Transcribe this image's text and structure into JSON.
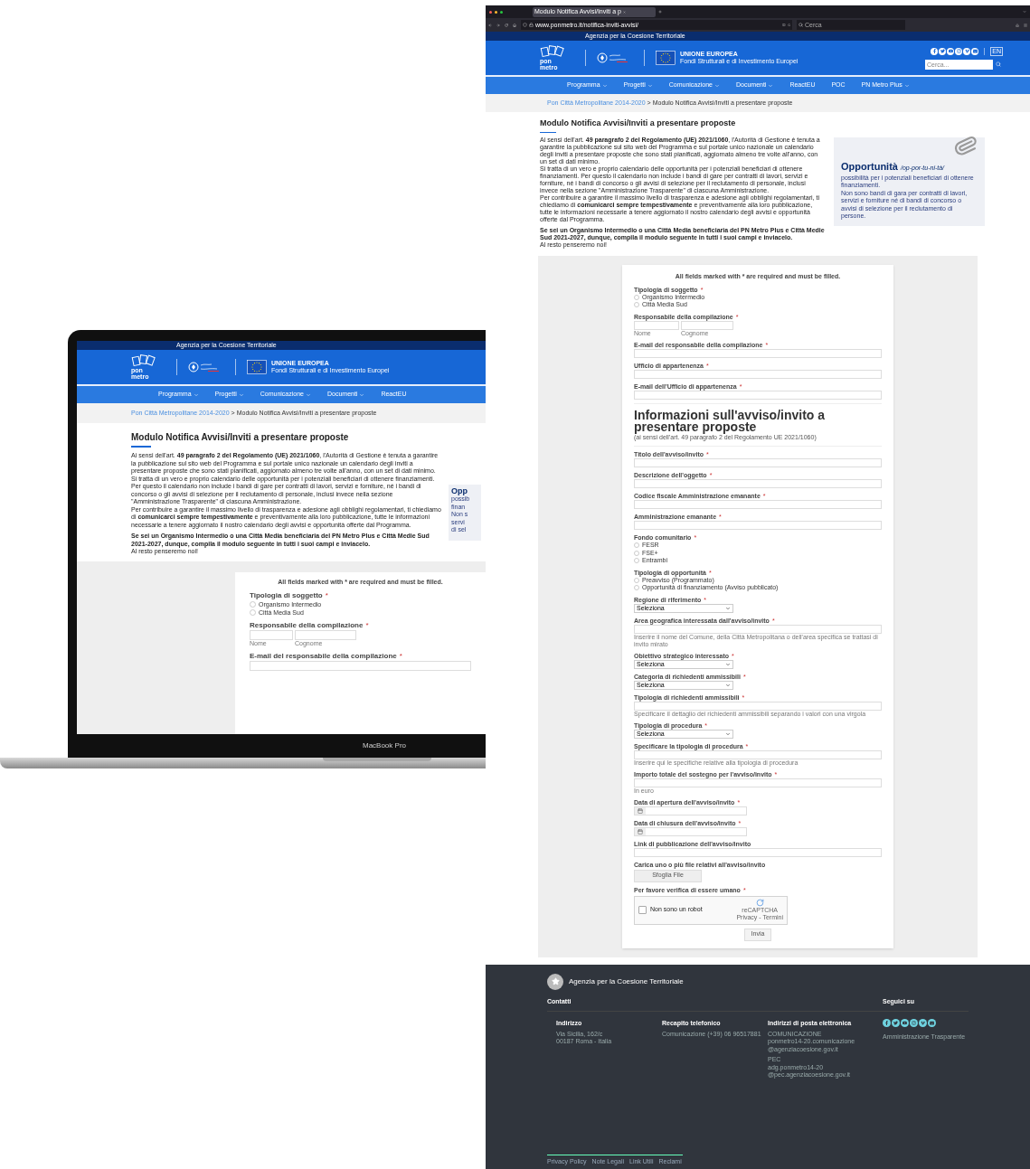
{
  "laptop": {
    "site": {
      "top_bar": "Agenzia per la Coesione Territoriale",
      "logo_text": "pon metro",
      "eu_title": "UNIONE EUROPEA",
      "eu_subtitle": "Fondi Strutturali e di Investimento Europei",
      "nav": [
        {
          "label": "Programma",
          "dropdown": true
        },
        {
          "label": "Progetti",
          "dropdown": true
        },
        {
          "label": "Comunicazione",
          "dropdown": true
        },
        {
          "label": "Documenti",
          "dropdown": true
        },
        {
          "label": "ReactEU",
          "dropdown": false
        }
      ]
    },
    "breadcrumb": {
      "link": "Pon Città Metropolitane 2014-2020",
      "separator": ">",
      "current": "Modulo Notifica Avvisi/Inviti a presentare proposte"
    },
    "title": "Modulo Notifica Avvisi/Inviti a presentare proposte",
    "intro": [
      {
        "text": "Ai sensi dell'art. **49 paragrafo 2 del Regolamento (UE) 2021/1060**, l'Autorità di Gestione è tenuta a garantire la pubblicazione sul sito web del Programma e sul portale unico nazionale un calendario degli inviti a presentare proposte che sono stati pianificati, aggiornato almeno tre volte all'anno, con un set di dati minimo.",
        "emphasis": false
      },
      {
        "text": "Si tratta di un vero e proprio calendario delle opportunità per i potenziali beneficiari di ottenere finanziamenti. Per questo il calendario non include i bandi di gare per contratti di lavori, servizi e forniture, né i bandi di concorso o gli avvisi di selezione per il reclutamento di personale, inclusi invece nella sezione \"Amministrazione Trasparente\" di ciascuna Amministrazione.",
        "emphasis": false
      },
      {
        "text": "Per contribuire a garantire il massimo livello di trasparenza e adesione agli obblighi regolamentari, ti chiediamo di **comunicarci sempre tempestivamente** e preventivamente alla loro pubblicazione, tutte le informazioni necessarie a tenere aggiornato il nostro calendario degli avvisi e opportunità offerte dal Programma.",
        "emphasis": false
      },
      {
        "text": "Se sei un Organismo Intermedio o una Città Media beneficiaria del PN Metro Plus e Città Medie Sud 2021-2027, dunque, compila il modulo seguente in tutti i suoi campi e inviacelo.",
        "emphasis": true
      },
      {
        "text": "Al resto penseremo noi!",
        "emphasis": false
      }
    ],
    "box_fragments": [
      "Opp",
      "possib",
      "finan",
      "Non s",
      "servi",
      "di sel"
    ],
    "form": {
      "notice": "All fields marked with * are required and must be filled.",
      "fields": [
        {
          "kind": "radio",
          "label": "Tipologia di soggetto",
          "mark": "*",
          "options": [
            {
              "label": "Organismo Intermedio",
              "selected": false
            },
            {
              "label": "Città Media Sud",
              "selected": false
            }
          ]
        },
        {
          "kind": "name",
          "label": "Responsabile della compilazione",
          "mark": "*",
          "sublabels": [
            "Nome",
            "Cognome"
          ]
        },
        {
          "kind": "text",
          "label": "E-mail del responsabile della compilazione",
          "mark": "*"
        }
      ]
    },
    "device_label": "MacBook Pro"
  },
  "browser": {
    "tab_title": "Modulo Notifica Avvisi/Inviti a p",
    "url": "www.ponmetro.it/notifica-inviti-avvisi/",
    "search_placeholder": "Cerca"
  },
  "page": {
    "site": {
      "top_bar": "Agenzia per la Coesione Territoriale",
      "logo_text": "pon metro",
      "eu_title": "UNIONE EUROPEA",
      "eu_subtitle": "Fondi Strutturali e di Investimento Europei",
      "lang": "EN",
      "search_placeholder": "Cerca...",
      "nav": [
        {
          "label": "Programma",
          "dropdown": true
        },
        {
          "label": "Progetti",
          "dropdown": true
        },
        {
          "label": "Comunicazione",
          "dropdown": true
        },
        {
          "label": "Documenti",
          "dropdown": true
        },
        {
          "label": "ReactEU",
          "dropdown": false
        },
        {
          "label": "POC",
          "dropdown": false
        },
        {
          "label": "PN Metro Plus",
          "dropdown": true
        }
      ]
    },
    "breadcrumb": {
      "link": "Pon Città Metropolitane 2014-2020",
      "separator": ">",
      "current": "Modulo Notifica Avvisi/Inviti a presentare proposte"
    },
    "title": "Modulo Notifica Avvisi/Inviti a presentare proposte",
    "intro": [
      {
        "text": "Ai sensi dell'art. **49 paragrafo 2 del Regolamento (UE) 2021/1060**, l'Autorità di Gestione è tenuta a garantire la pubblicazione sul sito web del Programma e sul portale unico nazionale un calendario degli inviti a presentare proposte che sono stati pianificati, aggiornato almeno tre volte all'anno, con un set di dati minimo.",
        "emphasis": false
      },
      {
        "text": "Si tratta di un vero e proprio calendario delle opportunità per i potenziali beneficiari di ottenere finanziamenti. Per questo il calendario non include i bandi di gare per contratti di lavori, servizi e forniture, né i bandi di concorso o gli avvisi di selezione per il reclutamento di personale, inclusi invece nella sezione \"Amministrazione Trasparente\" di ciascuna Amministrazione.",
        "emphasis": false
      },
      {
        "text": "Per contribuire a garantire il massimo livello di trasparenza e adesione agli obblighi regolamentari, ti chiediamo di **comunicarci sempre tempestivamente** e preventivamente alla loro pubblicazione, tutte le informazioni necessarie a tenere aggiornato il nostro calendario degli avvisi e opportunità offerte dal Programma.",
        "emphasis": false
      },
      {
        "text": "Se sei un Organismo Intermedio o una Città Media beneficiaria del PN Metro Plus e Città Medie Sud 2021-2027, dunque, compila il modulo seguente in tutti i suoi campi e inviacelo.",
        "emphasis": true
      },
      {
        "text": "Al resto penseremo noi!",
        "emphasis": false
      }
    ],
    "box": {
      "title": "Opportunità",
      "phonetic": "/op-por-tu-ni-tà/",
      "lines": [
        "possibilità per i potenziali beneficiari di ottenere finanziamenti.",
        "Non sono bandi di gara per contratti di lavori, servizi e forniture né di bandi di concorso o avvisi di selezione per il reclutamento di persone."
      ]
    },
    "form": {
      "notice": "All fields marked with * are required and must be filled.",
      "fields": [
        {
          "kind": "radio",
          "label": "Tipologia di soggetto",
          "mark": "*",
          "options": [
            {
              "label": "Organismo Intermedio",
              "selected": false
            },
            {
              "label": "Città Media Sud",
              "selected": false
            }
          ]
        },
        {
          "kind": "name",
          "label": "Responsabile della compilazione",
          "mark": "*",
          "sublabels": [
            "Nome",
            "Cognome"
          ]
        },
        {
          "kind": "text",
          "label": "E-mail del responsabile della compilazione",
          "mark": "*"
        },
        {
          "kind": "text",
          "label": "Ufficio di appartenenza",
          "mark": "*"
        },
        {
          "kind": "text",
          "label": "E-mail dell'Ufficio di appartenenza",
          "mark": "*"
        },
        {
          "kind": "heading",
          "label": "Informazioni sull'avviso/invito a presentare proposte",
          "note": "(ai sensi dell'art. 49 paragrafo 2 del Regolamento UE 2021/1060)"
        },
        {
          "kind": "text",
          "label": "Titolo dell'avviso/invito",
          "mark": "*"
        },
        {
          "kind": "text",
          "label": "Descrizione dell'oggetto",
          "mark": "*"
        },
        {
          "kind": "text",
          "label": "Codice fiscale Amministrazione emanante",
          "mark": "*"
        },
        {
          "kind": "text",
          "label": "Amministrazione emanante",
          "mark": "*"
        },
        {
          "kind": "radio",
          "label": "Fondo comunitario",
          "mark": "*",
          "options": [
            {
              "label": "FESR",
              "selected": false
            },
            {
              "label": "FSE+",
              "selected": false
            },
            {
              "label": "Entrambi",
              "selected": false
            }
          ]
        },
        {
          "kind": "radio",
          "label": "Tipologia di opportunità",
          "mark": "*",
          "options": [
            {
              "label": "Preavviso (Programmato)",
              "selected": false
            },
            {
              "label": "Opportunità di finanziamento (Avviso pubblicato)",
              "selected": false
            }
          ]
        },
        {
          "kind": "select",
          "label": "Regione di riferimento",
          "mark": "*",
          "value": "Seleziona"
        },
        {
          "kind": "text",
          "label": "Area geografica interessata dall'avviso/invito",
          "mark": "*",
          "help": "Inserire il nome del Comune, della Città Metropolitana o dell'area specifica se trattasi di invito mirato"
        },
        {
          "kind": "select",
          "label": "Obiettivo strategico interessato",
          "mark": "*",
          "value": "Seleziona"
        },
        {
          "kind": "select",
          "label": "Categoria di richiedenti ammissibili",
          "mark": "*",
          "value": "Seleziona"
        },
        {
          "kind": "text",
          "label": "Tipologia di richiedenti ammissibili",
          "mark": "*",
          "help": "Specificare il dettaglio dei richiedenti ammissibili separando i valori con una virgola"
        },
        {
          "kind": "select",
          "label": "Tipologia di procedura",
          "mark": "*",
          "value": "Seleziona"
        },
        {
          "kind": "text",
          "label": "Specificare la tipologia di procedura",
          "mark": "*",
          "help": "Inserire qui le specifiche relative alla tipologia di procedura"
        },
        {
          "kind": "text",
          "label": "Importo totale del sostegno per l'avviso/invito",
          "mark": "*",
          "help": "In euro"
        },
        {
          "kind": "date",
          "label": "Data di apertura dell'avviso/invito",
          "mark": "*"
        },
        {
          "kind": "date",
          "label": "Data di chiusura dell'avviso/invito",
          "mark": "*"
        },
        {
          "kind": "text",
          "label": "Link di pubblicazione dell'avviso/invito"
        },
        {
          "kind": "file",
          "label": "Carica uno o più file relativi all'avviso/invito",
          "button": "Sfoglia File"
        },
        {
          "kind": "captcha",
          "label": "Per favore verifica di essere umano",
          "mark": "*",
          "checkbox": "Non sono un robot",
          "checked": false,
          "brand": "reCAPTCHA",
          "links": "Privacy - Termini"
        }
      ],
      "submit": "Invia"
    }
  },
  "footer": {
    "agency": "Agenzia per la Coesione Territoriale",
    "contacts_title": "Contatti",
    "follow_title": "Seguici su",
    "columns": [
      {
        "title": "Indirizzo",
        "lines": [
          "Via Sicilia, 162/c",
          "00187 Roma - Italia"
        ]
      },
      {
        "title": "Recapito telefonico",
        "lines": [
          "Comunicazione (+39) 06 96517881"
        ]
      },
      {
        "title": "Indirizzi di posta elettronica",
        "lines": [
          "COMUNICAZIONE",
          "ponmetro14-20.comunicazione",
          "@agenziacoesione.gov.it",
          "PEC",
          "adg.ponmetro14-20",
          "@pec.agenziacoesione.gov.it"
        ]
      }
    ],
    "transparency": "Amministrazione Trasparente",
    "links": [
      "Privacy Policy",
      "Note Legali",
      "Link Utili",
      "Reclami"
    ]
  }
}
